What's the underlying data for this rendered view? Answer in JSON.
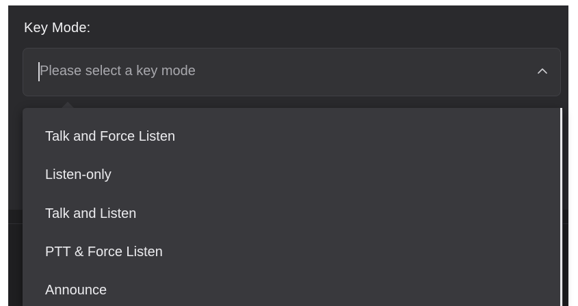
{
  "form": {
    "label": "Key Mode:",
    "select": {
      "placeholder": "Please select a key mode",
      "icon": "chevron-up-icon",
      "expanded": true
    },
    "options": [
      "Talk and Force Listen",
      "Listen-only",
      "Talk and Listen",
      "PTT & Force Listen",
      "Announce"
    ]
  },
  "colors": {
    "background": "#2a2a2d",
    "select_bg": "#333336",
    "dropdown_bg": "#39393d",
    "text": "#ececef",
    "placeholder": "#a8a8ad"
  }
}
